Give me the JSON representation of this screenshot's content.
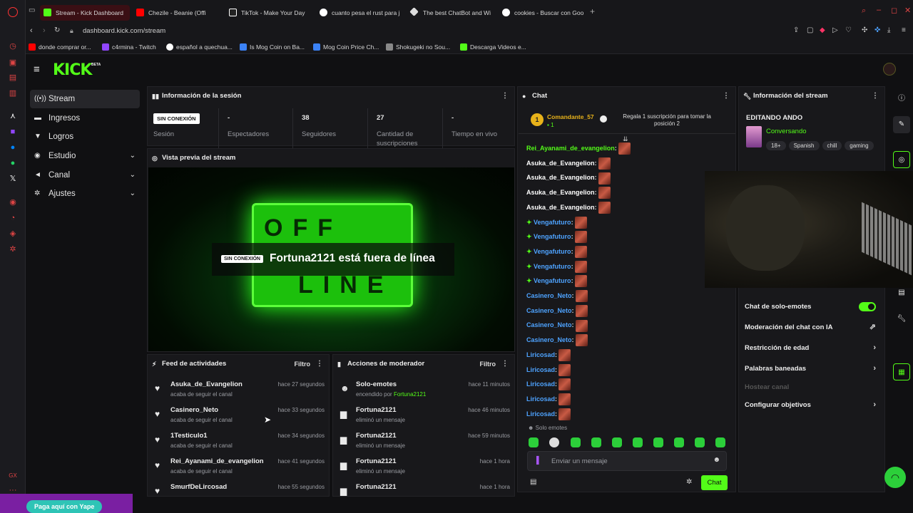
{
  "browser": {
    "tabs": [
      {
        "label": "Stream - Kick Dashboard",
        "color": "#53fc18"
      },
      {
        "label": "Chezile - Beanie (Offi",
        "color": "#ff0000"
      },
      {
        "label": "TikTok - Make Your Day",
        "color": "#ffffff"
      },
      {
        "label": "cuanto pesa el rust para j",
        "color": "#4285f4"
      },
      {
        "label": "The best ChatBot and Wi",
        "color": "#bbbbbb"
      },
      {
        "label": "cookies - Buscar con Goo",
        "color": "#4285f4"
      }
    ],
    "new_tab": "+",
    "url": "dashboard.kick.com/stream",
    "bookmarks": [
      {
        "label": "donde comprar or...",
        "color": "#ff0000"
      },
      {
        "label": "c4rmina - Twitch",
        "color": "#9146ff"
      },
      {
        "label": "español a quechua...",
        "color": "#4285f4"
      },
      {
        "label": "Is Mog Coin on Ba...",
        "color": "#3b82f6"
      },
      {
        "label": "Mog Coin Price Ch...",
        "color": "#3b82f6"
      },
      {
        "label": "Shokugeki no Sou...",
        "color": "#888888"
      },
      {
        "label": "Descarga Videos e...",
        "color": "#53fc18"
      }
    ]
  },
  "kick": {
    "logo": "KICK",
    "logo_badge": "BETA",
    "brand_color": "#53fc18",
    "nav": [
      {
        "label": "Stream",
        "active": true
      },
      {
        "label": "Ingresos"
      },
      {
        "label": "Logros"
      },
      {
        "label": "Estudio",
        "expandable": true
      },
      {
        "label": "Canal",
        "expandable": true
      },
      {
        "label": "Ajustes",
        "expandable": true
      }
    ],
    "session": {
      "title": "Información de la sesión",
      "status_badge": "SIN CONEXIÓN",
      "stats": [
        {
          "value": "",
          "label": "Sesión"
        },
        {
          "value": "-",
          "label": "Espectadores"
        },
        {
          "value": "38",
          "label": "Seguidores"
        },
        {
          "value": "27",
          "label": "Cantidad de suscripciones"
        },
        {
          "value": "-",
          "label": "Tiempo en vivo"
        }
      ]
    },
    "preview": {
      "title": "Vista previa del stream",
      "badge": "SIN CONEXIÓN",
      "message": "Fortuna2121 está fuera de línea",
      "bg_letters_top": "OFF",
      "bg_letters_bottom": "LINE"
    },
    "feed": {
      "title": "Feed de actividades",
      "filter": "Filtro",
      "items": [
        {
          "name": "Asuka_de_Evangelion",
          "sub": "acaba de seguir el canal",
          "time": "hace 27 segundos"
        },
        {
          "name": "Casinero_Neto",
          "sub": "acaba de seguir el canal",
          "time": "hace 33 segundos"
        },
        {
          "name": "1Testiculo1",
          "sub": "acaba de seguir el canal",
          "time": "hace 34 segundos"
        },
        {
          "name": "Rei_Ayanami_de_evangelion",
          "sub": "acaba de seguir el canal",
          "time": "hace 41 segundos"
        },
        {
          "name": "SmurfDeLircosad",
          "sub": "",
          "time": "hace 55 segundos"
        }
      ]
    },
    "mod": {
      "title": "Acciones de moderador",
      "filter": "Filtro",
      "items": [
        {
          "name": "Solo-emotes",
          "sub": "encendido por",
          "who": "Fortuna2121",
          "time": "hace 11 minutos"
        },
        {
          "name": "Fortuna2121",
          "sub": "eliminó un mensaje",
          "who": "",
          "time": "hace 46 minutos"
        },
        {
          "name": "Fortuna2121",
          "sub": "eliminó un mensaje",
          "who": "",
          "time": "hace 59 minutos"
        },
        {
          "name": "Fortuna2121",
          "sub": "eliminó un mensaje",
          "who": "",
          "time": "hace 1 hora"
        },
        {
          "name": "Fortuna2121",
          "sub": "",
          "who": "",
          "time": "hace 1 hora"
        }
      ]
    },
    "chat": {
      "title": "Chat",
      "pinned_user": "Comandante_57",
      "pinned_rank": "1",
      "pinned_count": "1",
      "pinned_msg": "Regala 1 suscripción para tomar la posición 2",
      "messages": [
        {
          "user": "Rei_Ayanami_de_evangelion",
          "color": "#53fc18",
          "badge": false
        },
        {
          "user": "Asuka_de_Evangelion",
          "color": "#ffffff",
          "badge": false
        },
        {
          "user": "Asuka_de_Evangelion",
          "color": "#ffffff",
          "badge": false
        },
        {
          "user": "Asuka_de_Evangelion",
          "color": "#ffffff",
          "badge": false
        },
        {
          "user": "Asuka_de_Evangelion",
          "color": "#ffffff",
          "badge": false
        },
        {
          "user": "Vengafuturo",
          "color": "#4ea3ff",
          "badge": true
        },
        {
          "user": "Vengafuturo",
          "color": "#4ea3ff",
          "badge": true
        },
        {
          "user": "Vengafuturo",
          "color": "#4ea3ff",
          "badge": true
        },
        {
          "user": "Vengafuturo",
          "color": "#4ea3ff",
          "badge": true
        },
        {
          "user": "Vengafuturo",
          "color": "#4ea3ff",
          "badge": true
        },
        {
          "user": "Casinero_Neto",
          "color": "#4ea3ff",
          "badge": false
        },
        {
          "user": "Casinero_Neto",
          "color": "#4ea3ff",
          "badge": false
        },
        {
          "user": "Casinero_Neto",
          "color": "#4ea3ff",
          "badge": false
        },
        {
          "user": "Casinero_Neto",
          "color": "#4ea3ff",
          "badge": false
        },
        {
          "user": "Liricosad",
          "color": "#4ea3ff",
          "badge": false
        },
        {
          "user": "Liricosad",
          "color": "#4ea3ff",
          "badge": false
        },
        {
          "user": "Liricosad",
          "color": "#4ea3ff",
          "badge": false
        },
        {
          "user": "Liricosad",
          "color": "#4ea3ff",
          "badge": false
        },
        {
          "user": "Liricosad",
          "color": "#4ea3ff",
          "badge": false
        }
      ],
      "emote_mode": "Solo emotes",
      "placeholder": "Enviar un mensaje",
      "send": "Chat"
    },
    "stream_info": {
      "title": "Información del stream",
      "stream_title": "EDITANDO ANDO",
      "category": "Conversando",
      "tags": [
        "18+",
        "Spanish",
        "chill",
        "gaming"
      ],
      "settings": [
        {
          "label": "Chat de solo-emotes",
          "control": "toggle",
          "on": true
        },
        {
          "label": "Moderación del chat con IA",
          "control": "external"
        },
        {
          "label": "Restricción de edad",
          "control": "chevron"
        },
        {
          "label": "Palabras baneadas",
          "control": "chevron"
        },
        {
          "label": "Hostear canal",
          "control": "none",
          "disabled": true
        },
        {
          "label": "Configurar objetivos",
          "control": "chevron"
        }
      ]
    },
    "yape_button": "Paga aquí con Yape"
  }
}
